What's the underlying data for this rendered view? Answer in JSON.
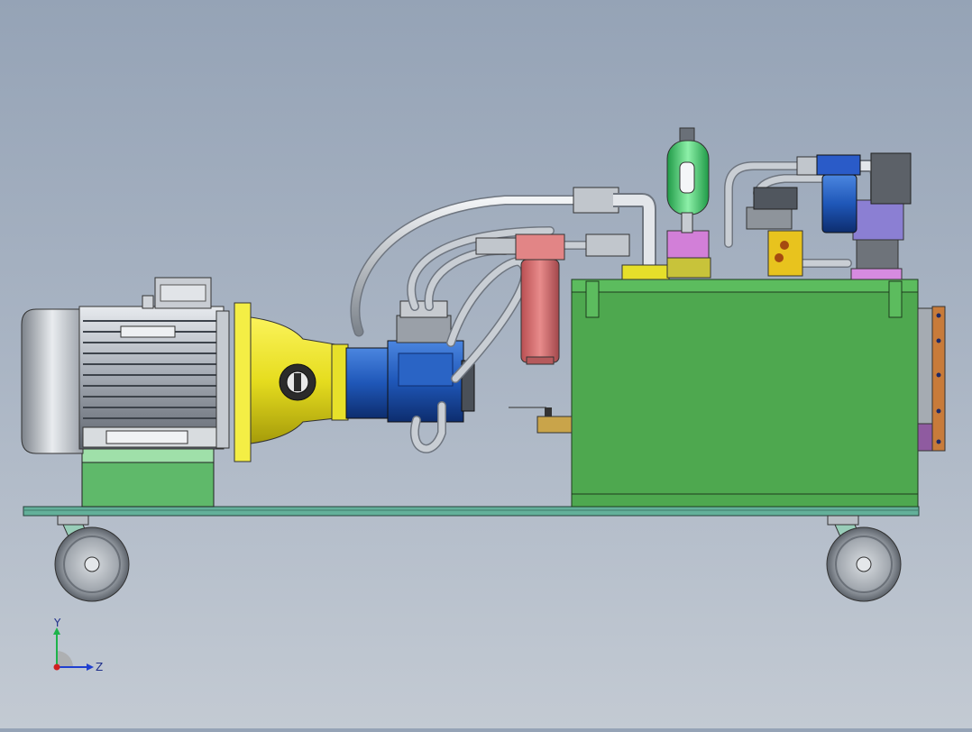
{
  "viewport": {
    "background_top": "#95a3b6",
    "background_bottom": "#c3cad3"
  },
  "model": {
    "components": [
      "electric-motor",
      "bell-housing-coupling",
      "hydraulic-pump",
      "return-filter",
      "bladder-accumulator",
      "valve-manifold",
      "oil-tank",
      "base-frame",
      "caster-wheels",
      "hoses"
    ],
    "colors": {
      "tank": "#4ea84f",
      "frame": "#63b09a",
      "coupling": "#e8e02a",
      "pump": "#1f57b8",
      "filter": "#d46a6a",
      "accumulator": "#38c46a",
      "manifold": "#c267c9",
      "motor": "#c8ccd3"
    }
  },
  "triad": {
    "y_label": "Y",
    "z_label": "Z",
    "y_color": "#1db34a",
    "z_color": "#1f3fd0",
    "x_color": "#d02020"
  }
}
